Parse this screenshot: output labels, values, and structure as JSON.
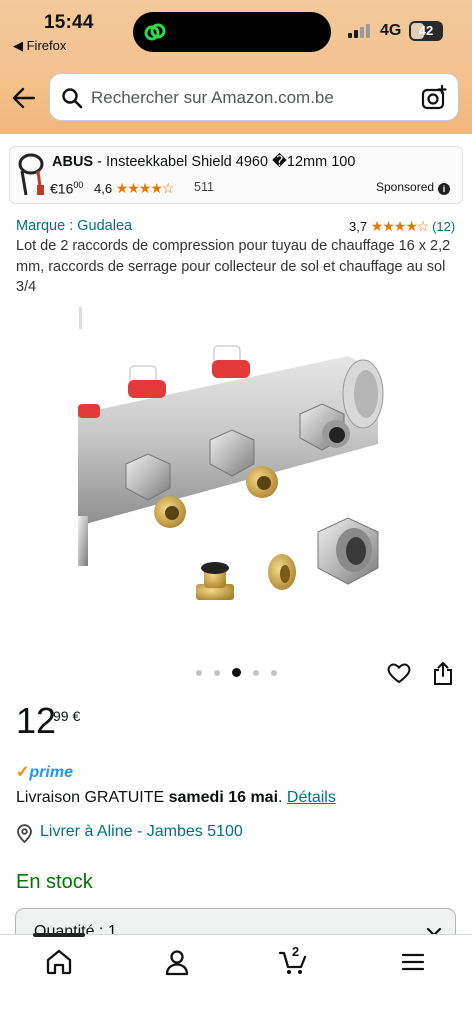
{
  "status_bar": {
    "time": "15:44",
    "back_app": "◀ Firefox",
    "network": "4G",
    "battery": "42",
    "battery_level": 0.42
  },
  "search": {
    "placeholder": "Rechercher sur Amazon.com.be"
  },
  "sponsored": {
    "brand": "ABUS",
    "title_rest": " - Insteekkabel Shield 4960 �12mm 100",
    "price_whole": "€16",
    "price_cents": "00",
    "rating": "4,6",
    "stars": "★★★★☆",
    "reviews": "511",
    "tag": "Sponsored"
  },
  "product": {
    "brand_link": "Marque : Gudalea",
    "rating": "3,7",
    "stars": "★★★★☆",
    "reviews": "(12)",
    "title": "Lot de 2 raccords de compression pour tuyau de chauffage 16 x 2,2 mm, raccords de serrage pour collecteur de sol et chauffage au sol 3/4",
    "image_count": 5,
    "active_image": 3
  },
  "price": {
    "whole": "12",
    "cents": "99 €"
  },
  "prime": {
    "check": "✓",
    "label": "prime"
  },
  "delivery": {
    "prefix": "Livraison GRATUITE ",
    "date": "samedi 16 mai",
    "suffix": ". ",
    "details_link": "Détails"
  },
  "location": {
    "text": "Livrer à Aline - Jambes 5100"
  },
  "stock": {
    "text": "En stock"
  },
  "quantity": {
    "label": "Quantité : 1"
  },
  "bottom_nav": {
    "cart_count": "2",
    "items": [
      "home-icon",
      "account-icon",
      "cart-icon",
      "menu-icon"
    ]
  },
  "colors": {
    "header_orange": "#f4c28e",
    "link": "#007185",
    "star": "#e77600",
    "stock_green": "#007600",
    "prime_blue": "#1a98ff"
  }
}
